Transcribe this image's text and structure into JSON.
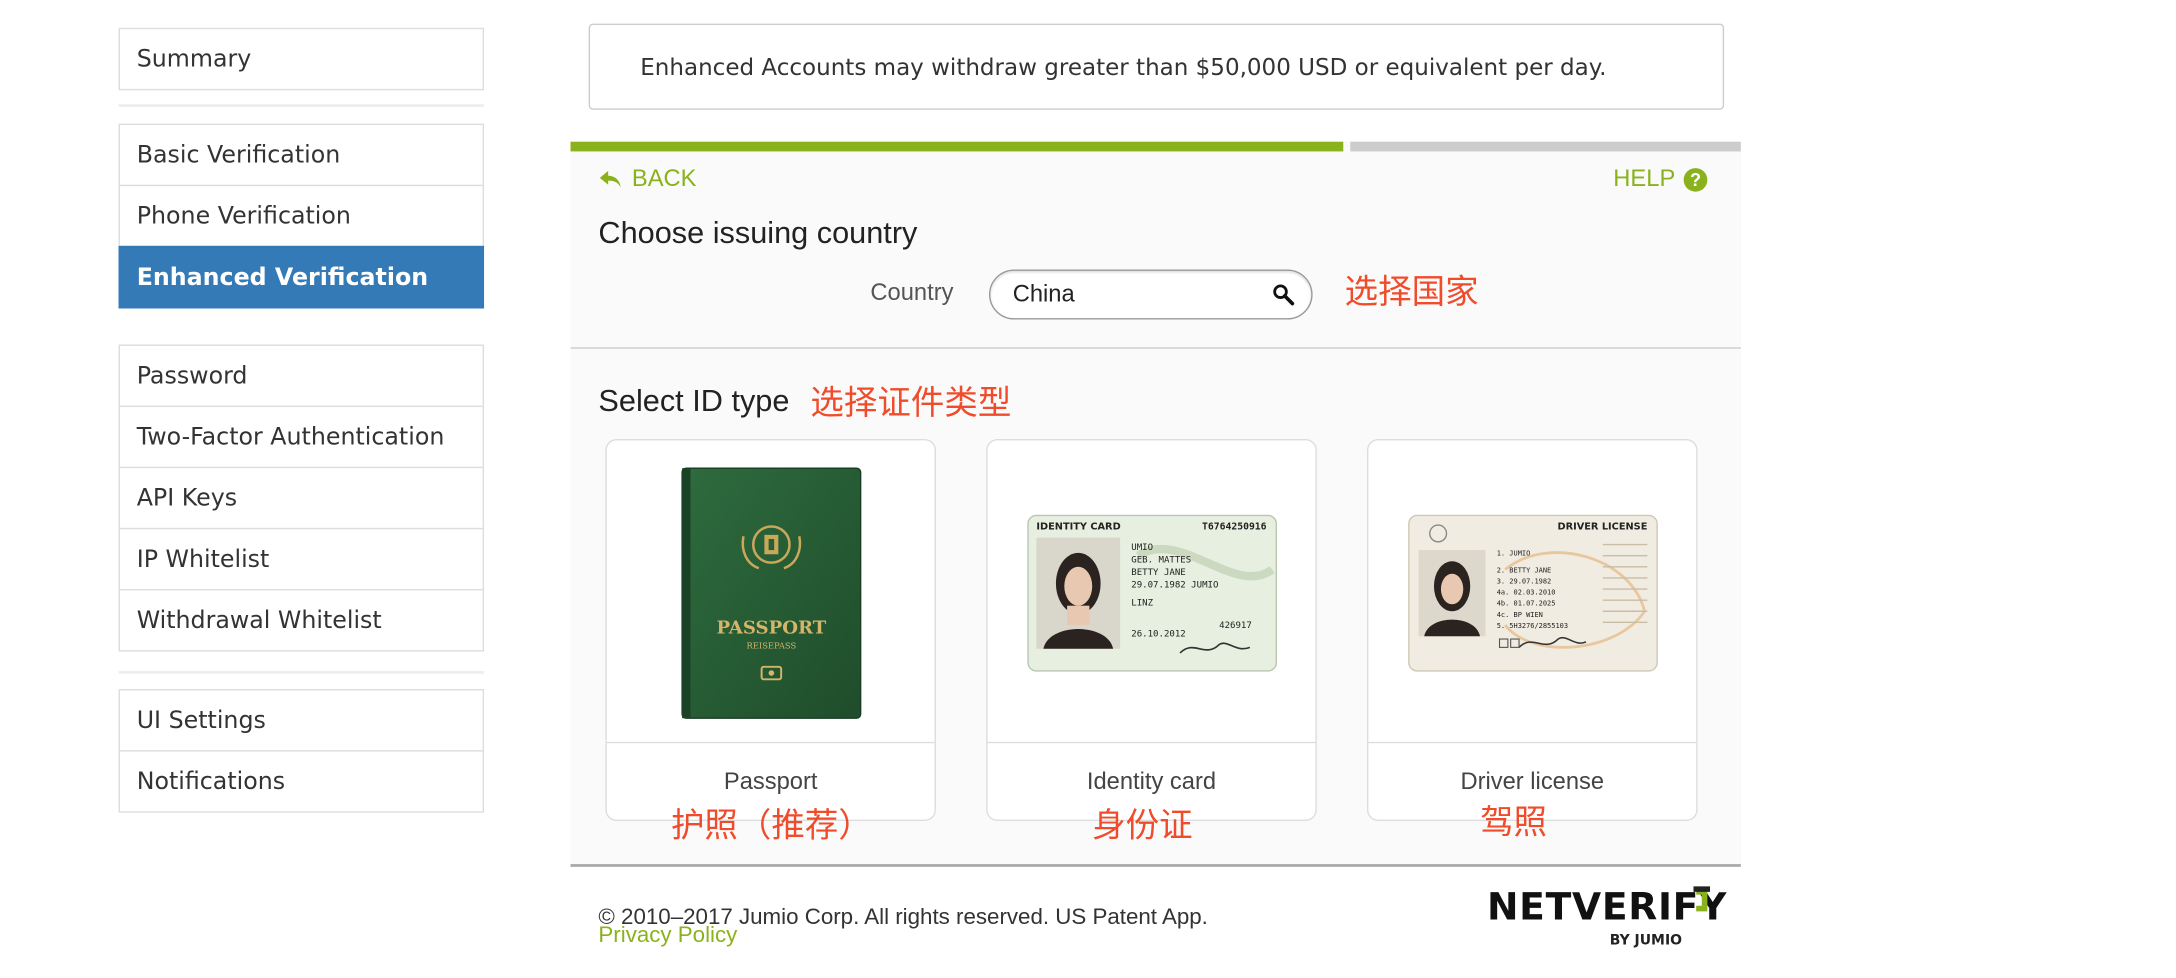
{
  "sidebar": {
    "groups": [
      [
        "Summary"
      ],
      [
        "Basic Verification",
        "Phone Verification",
        "Enhanced Verification"
      ],
      [
        "Password",
        "Two-Factor Authentication",
        "API Keys",
        "IP Whitelist",
        "Withdrawal Whitelist"
      ],
      [
        "UI Settings",
        "Notifications"
      ]
    ],
    "active": "Enhanced Verification"
  },
  "notice": {
    "text": "Enhanced Accounts may withdraw greater than $50,000 USD or equivalent per day."
  },
  "widget": {
    "progress_fraction": 0.66,
    "back_label": "BACK",
    "help_label": "HELP",
    "help_icon_glyph": "?",
    "country_heading": "Choose issuing country",
    "country_label": "Country",
    "country_value": "China",
    "country_annotation": "选择国家",
    "idtype_heading": "Select ID type",
    "idtype_annotation": "选择证件类型",
    "id_types": [
      {
        "label": "Passport",
        "annotation": "护照（推荐）",
        "icon": "passport-image",
        "cover_title": "PASSPORT",
        "cover_sub": "REISEPASS"
      },
      {
        "label": "Identity card",
        "annotation": "身份证",
        "icon": "identity-card-image",
        "card_title": "IDENTITY CARD",
        "card_number": "T6764250916",
        "lines": [
          "UMIO",
          "GEB. MATTES",
          "BETTY JANE",
          "29.07.1982 JUMIO",
          "LINZ",
          "26.10.2012"
        ],
        "side_number": "426917"
      },
      {
        "label": "Driver license",
        "annotation": "驾照",
        "icon": "driver-license-image",
        "card_title": "DRIVER LICENSE",
        "lines": [
          "1. JUMIO",
          "2. BETTY JANE",
          "3. 29.07.1982",
          "4a. 02.03.2010",
          "4b. 01.07.2025",
          "4c. BP WIEN",
          "5. 5H3276/2855103"
        ]
      }
    ]
  },
  "footer": {
    "copyright": "© 2010–2017 Jumio Corp. All rights reserved. US Patent App.",
    "privacy": "Privacy Policy",
    "logo_word": "NETVERIFY",
    "logo_sub": "BY JUMIO"
  },
  "colors": {
    "accent_green": "#8ab21d",
    "active_blue": "#337ab7",
    "annotation_red": "#f04b2a"
  }
}
